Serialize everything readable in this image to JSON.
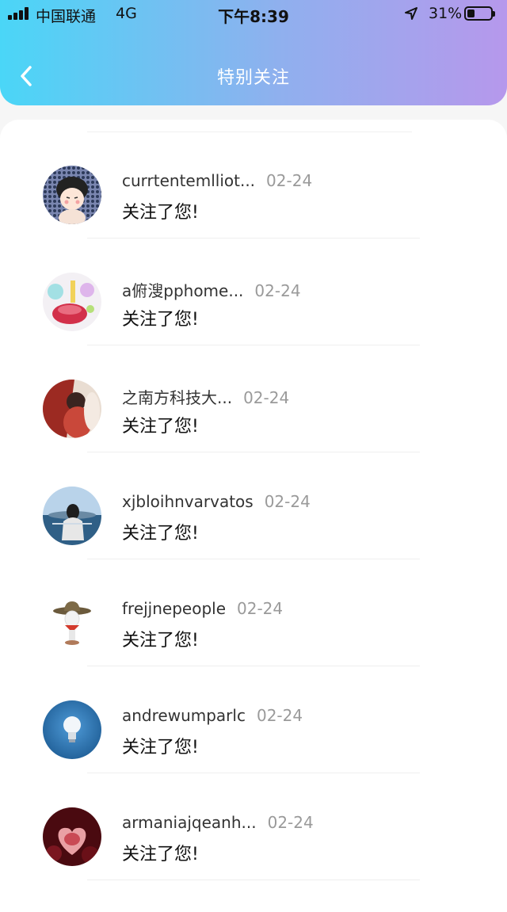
{
  "status_bar": {
    "carrier": "中国联通",
    "network": "4G",
    "time": "下午8:39",
    "battery_percent_text": "31%",
    "battery_level": 0.31,
    "location_icon": "location-arrow-icon"
  },
  "nav": {
    "title": "特别关注",
    "back_icon": "chevron-left-icon"
  },
  "colors": {
    "header_gradient_start": "#4ad6f7",
    "header_gradient_end": "#b698ec",
    "name_text": "#333333",
    "date_text": "#9a9a9a"
  },
  "notifications": [
    {
      "name": "currtentemlliot...",
      "date": "02-24",
      "message": "关注了您!"
    },
    {
      "name": "a俯溲pphome...",
      "date": "02-24",
      "message": "关注了您!"
    },
    {
      "name": "之南方科技大...",
      "date": "02-24",
      "message": "关注了您!"
    },
    {
      "name": "xjbloihnvarvatos",
      "date": "02-24",
      "message": "关注了您!"
    },
    {
      "name": "frejjnepeople",
      "date": "02-24",
      "message": "关注了您!"
    },
    {
      "name": "andrewumparlc",
      "date": "02-24",
      "message": "关注了您!"
    },
    {
      "name": "armaniajqeanh...",
      "date": "02-24",
      "message": "关注了您!"
    }
  ]
}
